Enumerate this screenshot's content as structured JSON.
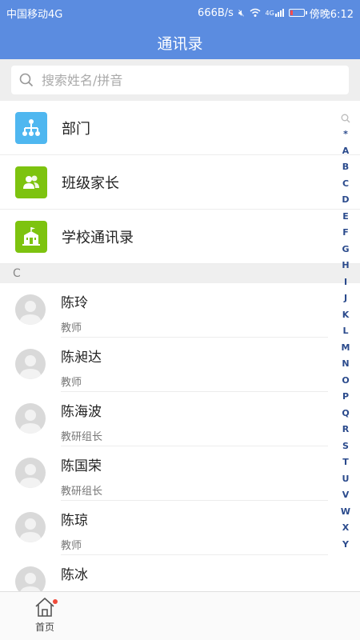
{
  "status_bar": {
    "carrier": "中国移动4G",
    "speed": "666B/s",
    "signal_label": "4G",
    "time": "傍晚6:12"
  },
  "header": {
    "title": "通讯录"
  },
  "search": {
    "placeholder": "搜索姓名/拼音"
  },
  "menu": [
    {
      "label": "部门",
      "icon": "org-chart-icon",
      "color": "#4fb7f0"
    },
    {
      "label": "班级家长",
      "icon": "users-icon",
      "color": "#7dc30f"
    },
    {
      "label": "学校通讯录",
      "icon": "school-icon",
      "color": "#7dc30f"
    }
  ],
  "section_letter": "C",
  "contacts": [
    {
      "name": "陈玲",
      "role": "教师"
    },
    {
      "name": "陈昶达",
      "role": "教师"
    },
    {
      "name": "陈海波",
      "role": "教研组长"
    },
    {
      "name": "陈国荣",
      "role": "教研组长"
    },
    {
      "name": "陈琼",
      "role": "教师"
    },
    {
      "name": "陈冰",
      "role": ""
    }
  ],
  "index_letters": [
    "*",
    "A",
    "B",
    "C",
    "D",
    "E",
    "F",
    "G",
    "H",
    "I",
    "J",
    "K",
    "L",
    "M",
    "N",
    "O",
    "P",
    "Q",
    "R",
    "S",
    "T",
    "U",
    "V",
    "W",
    "X",
    "Y"
  ],
  "bottom_nav": {
    "home_label": "首页",
    "notification_dot_color": "#f04a3a"
  },
  "colors": {
    "header": "#5b8ce0",
    "index_text": "#2a4a8c"
  }
}
